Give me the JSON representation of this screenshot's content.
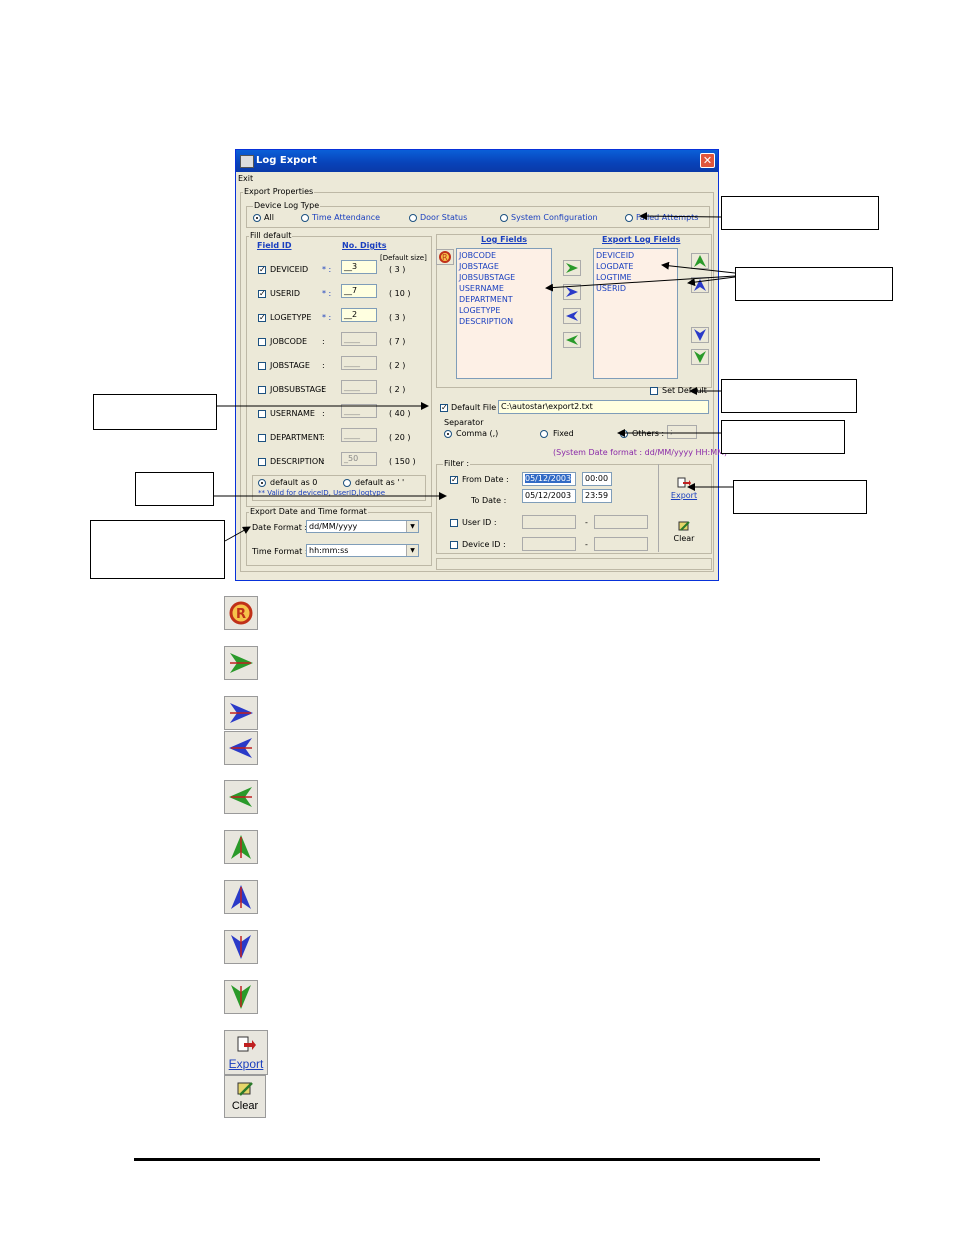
{
  "window": {
    "title": "Log Export",
    "close_glyph": "✕",
    "menu": "Exit"
  },
  "export_properties": {
    "legend": "Export Properties",
    "device_log_type": {
      "legend": "Device Log Type",
      "options": [
        "All",
        "Time Attendance",
        "Door Status",
        "System Configuration",
        "Failed Attempts"
      ],
      "selected": "All"
    },
    "fill_default": {
      "legend": "Fill default",
      "col_field": "Field ID",
      "col_digits": "No. Digits",
      "col_default": "[Default size]",
      "rows": [
        {
          "field": "DEVICEID",
          "checked": true,
          "sep": "* :",
          "value": "__3",
          "size": "( 3 )"
        },
        {
          "field": "USERID",
          "checked": true,
          "sep": "* :",
          "value": "__7",
          "size": "( 10 )"
        },
        {
          "field": "LOGETYPE",
          "checked": true,
          "sep": "* :",
          "value": "__2",
          "size": "( 3 )"
        },
        {
          "field": "JOBCODE",
          "checked": false,
          "sep": ":",
          "value": "____",
          "size": "( 7 )"
        },
        {
          "field": "JOBSTAGE",
          "checked": false,
          "sep": ":",
          "value": "____",
          "size": "( 2 )"
        },
        {
          "field": "JOBSUBSTAGE",
          "checked": false,
          "sep": ":",
          "value": "____",
          "size": "( 2 )"
        },
        {
          "field": "USERNAME",
          "checked": false,
          "sep": ":",
          "value": "____",
          "size": "( 40 )"
        },
        {
          "field": "DEPARTMENT",
          "checked": false,
          "sep": ":",
          "value": "____",
          "size": "( 20 )"
        },
        {
          "field": "DESCRIPTION",
          "checked": false,
          "sep": ":",
          "value": "_50",
          "size": "( 150 )"
        }
      ],
      "default_as_0": "default as 0",
      "default_as_blank": "default as ' '",
      "note": "** Valid for deviceID, UserID,logtype"
    },
    "date_time": {
      "legend": "Export Date and Time format",
      "date_label": "Date Format :",
      "date_value": "dd/MM/yyyy",
      "time_label": "Time Format :",
      "time_value": "hh:mm:ss"
    },
    "log_fields": {
      "title": "Log Fields",
      "items": [
        "JOBCODE",
        "JOBSTAGE",
        "JOBSUBSTAGE",
        "USERNAME",
        "DEPARTMENT",
        "LOGETYPE",
        "DESCRIPTION"
      ]
    },
    "export_log_fields": {
      "title": "Export Log Fields",
      "items": [
        "DEVICEID",
        "LOGDATE",
        "LOGTIME",
        "USERID"
      ]
    },
    "set_default": "Set Default",
    "default_file": {
      "label": "Default File :",
      "value": "C:\\autostar\\export2.txt"
    },
    "separator": {
      "legend": "Separator",
      "options": [
        "Comma (,)",
        "Fixed",
        "Others :"
      ],
      "selected": "Comma (,)",
      "others_value": ";"
    },
    "system_date_format": "(System Date format : dd/MM/yyyy HH:MM)",
    "filter": {
      "legend": "Filter :",
      "from_label": "From Date :",
      "from_date": "05/12/2003",
      "from_time": "00:00",
      "to_label": "To Date :",
      "to_date": "05/12/2003",
      "to_time": "23:59",
      "userid_label": "User ID :",
      "deviceid_label": "Device ID :",
      "dash": "-"
    },
    "export_button": "Export",
    "clear_button": "Clear"
  },
  "legend_icons": {
    "export_label": "Export",
    "clear_label": "Clear"
  },
  "colors": {
    "title_bar": "#0a4fc8",
    "list_bg": "#fdf0e6",
    "field_text": "#1a3fbf"
  }
}
